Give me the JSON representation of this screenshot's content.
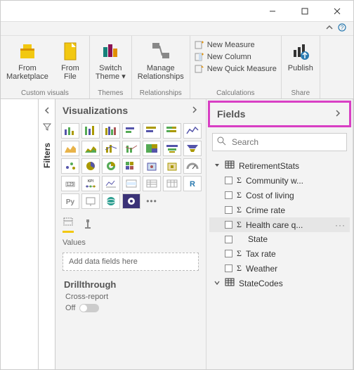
{
  "titlebar": {
    "min": "",
    "max": "",
    "close": ""
  },
  "ribbon": {
    "customVisuals": {
      "group": "Custom visuals",
      "fromMarketplace": "From\nMarketplace",
      "fromFile": "From\nFile"
    },
    "themes": {
      "group": "Themes",
      "switchTheme": "Switch\nTheme"
    },
    "relationships": {
      "group": "Relationships",
      "manage": "Manage\nRelationships"
    },
    "calculations": {
      "group": "Calculations",
      "newMeasure": "New Measure",
      "newColumn": "New Column",
      "newQuick": "New Quick Measure"
    },
    "share": {
      "group": "Share",
      "publish": "Publish"
    }
  },
  "filters": {
    "label": "Filters"
  },
  "viz": {
    "title": "Visualizations",
    "values": "Values",
    "placeholder": "Add data fields here",
    "drill": "Drillthrough",
    "cross": "Cross-report",
    "off": "Off"
  },
  "fields": {
    "title": "Fields",
    "searchPlaceholder": "Search",
    "tables": [
      {
        "name": "RetirementStats",
        "expanded": true,
        "fields": [
          {
            "name": "Community w...",
            "sigma": true
          },
          {
            "name": "Cost of living",
            "sigma": true
          },
          {
            "name": "Crime rate",
            "sigma": true
          },
          {
            "name": "Health care q...",
            "sigma": true,
            "hover": true
          },
          {
            "name": "State",
            "sigma": false
          },
          {
            "name": "Tax rate",
            "sigma": true
          },
          {
            "name": "Weather",
            "sigma": true
          }
        ]
      },
      {
        "name": "StateCodes",
        "expanded": false,
        "fields": []
      }
    ]
  }
}
